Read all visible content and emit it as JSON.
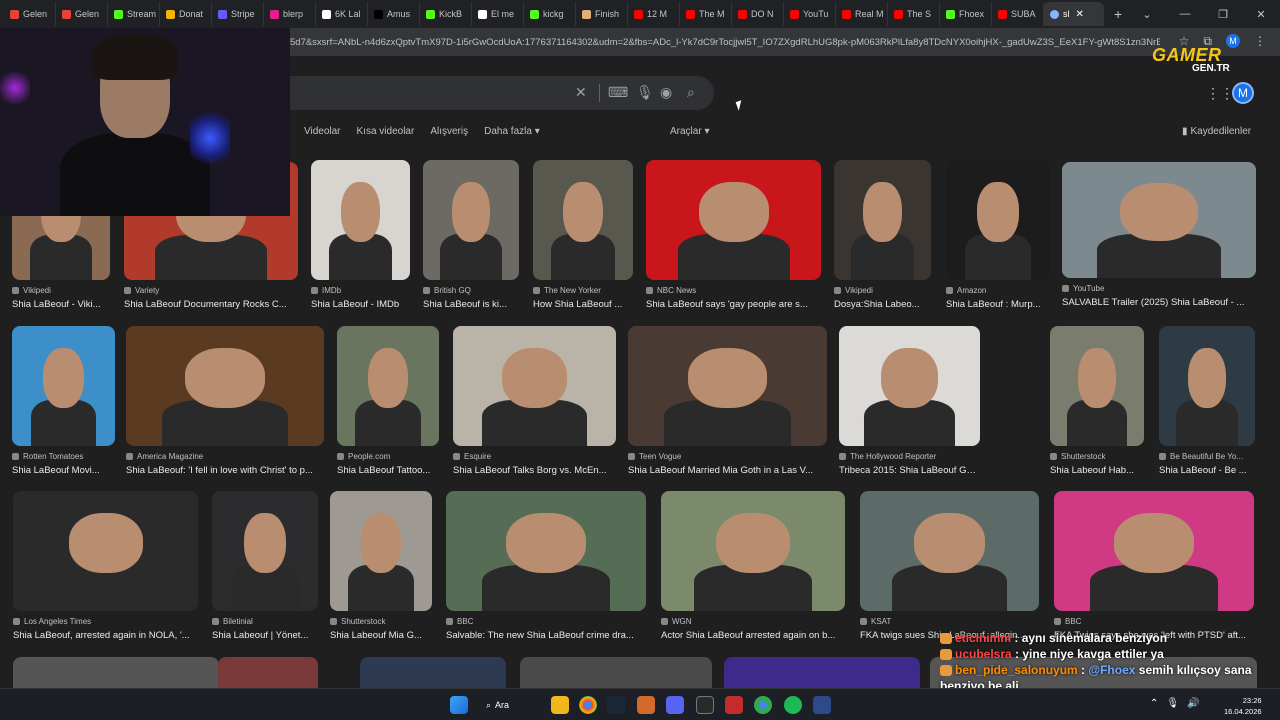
{
  "browser": {
    "tabs": [
      {
        "label": "Gelen",
        "color": "#ea4335"
      },
      {
        "label": "Gelen",
        "color": "#ea4335"
      },
      {
        "label": "Stream",
        "color": "#53fc18"
      },
      {
        "label": "Donat",
        "color": "#f4b400"
      },
      {
        "label": "Stripe",
        "color": "#635bff"
      },
      {
        "label": "blerp",
        "color": "#e91e8c"
      },
      {
        "label": "6K Lal",
        "color": "#ffffff"
      },
      {
        "label": "Amus",
        "color": "#000000"
      },
      {
        "label": "KickB",
        "color": "#53fc18"
      },
      {
        "label": "El me",
        "color": "#ffffff"
      },
      {
        "label": "kickg",
        "color": "#53fc18"
      },
      {
        "label": "Finish",
        "color": "#e2b077"
      },
      {
        "label": "12 M",
        "color": "#ff0000"
      },
      {
        "label": "The M",
        "color": "#ff0000"
      },
      {
        "label": "DO N",
        "color": "#ff0000"
      },
      {
        "label": "YouTu",
        "color": "#ff0000"
      },
      {
        "label": "Real M",
        "color": "#ff0000"
      },
      {
        "label": "The S",
        "color": "#ff0000"
      },
      {
        "label": "Fhoex",
        "color": "#53fc18"
      },
      {
        "label": "SUBA",
        "color": "#ff0000"
      }
    ],
    "active_tab": "sl",
    "url": "5d7&sxsrf=ANbL-n4d6zxQptvTmX97D-1i5rGwOcdUoA:1776371164302&udm=2&fbs=ADc_l-Yk7dC9rTocjjwl5T_IO7ZXgdRLhUG8pk-pM063RkPlLfa8y8TDcNYX0oihjHX-_gadUwZ3S_EeX1FY-gWt8S1zn3NrEJVcYP",
    "profile_initial": "M"
  },
  "overlay_logo": {
    "line1": "GAMER",
    "line2": "GEN.TR"
  },
  "search": {
    "value": ""
  },
  "filters": [
    "Videolar",
    "Kısa videolar",
    "Alışveriş",
    "Daha fazla ▾"
  ],
  "tools_label": "Araçlar ▾",
  "saved_label": "Kaydedilenler",
  "results": [
    {
      "source": "Vikipedi",
      "title": "Shia LaBeouf - Viki...",
      "bg": "#8a6a52"
    },
    {
      "source": "Variety",
      "title": "Shia LaBeouf Documentary Rocks C...",
      "bg": "#b23a2a"
    },
    {
      "source": "IMDb",
      "title": "Shia LaBeouf - IMDb",
      "bg": "#d8d4cf"
    },
    {
      "source": "British GQ",
      "title": "Shia LaBeouf is ki...",
      "bg": "#6c6a63"
    },
    {
      "source": "The New Yorker",
      "title": "How Shia LaBeouf ...",
      "bg": "#58584f"
    },
    {
      "source": "NBC News",
      "title": "Shia LaBeouf says 'gay people are s...",
      "bg": "#c8161b"
    },
    {
      "source": "Vikipedi",
      "title": "Dosya:Shia Labeo...",
      "bg": "#3a3530"
    },
    {
      "source": "Amazon",
      "title": "Shia LaBeouf : Murp...",
      "bg": "#1c1c1c"
    },
    {
      "source": "YouTube",
      "title": "SALVABLE Trailer (2025) Shia LaBeouf - ...",
      "bg": "#7c8a90"
    },
    {
      "source": "Rotten Tomatoes",
      "title": "Shia LaBeouf Movi...",
      "bg": "#3c8fc8"
    },
    {
      "source": "America Magazine",
      "title": "Shia LaBeouf: 'I fell in love with Christ' to p...",
      "bg": "#5a3a20"
    },
    {
      "source": "People.com",
      "title": "Shia LaBeouf Tattoo...",
      "bg": "#6a7560"
    },
    {
      "source": "Esquire",
      "title": "Shia LaBeouf Talks Borg vs. McEn...",
      "bg": "#b9b3a8"
    },
    {
      "source": "Teen Vogue",
      "title": "Shia LaBeouf Married Mia Goth in a Las V...",
      "bg": "#4a3a34"
    },
    {
      "source": "The Hollywood Reporter",
      "title": "Tribeca 2015: Shia LaBeouf Gets Candid ...",
      "bg": "#dcdad6"
    },
    {
      "source": "Shutterstock",
      "title": "Shia Labeouf Hab...",
      "bg": "#7a7c6e"
    },
    {
      "source": "Be Beautiful Be Yo...",
      "title": "Shia LaBeouf - Be ...",
      "bg": "#2e3a44"
    },
    {
      "source": "Los Angeles Times",
      "title": "Shia LaBeouf, arrested again in NOLA, '...",
      "bg": "#2a2a2a"
    },
    {
      "source": "Biletinial",
      "title": "Shia Labeouf | Yönet...",
      "bg": "#2c2c2e"
    },
    {
      "source": "Shutterstock",
      "title": "Shia Labeouf Mia G...",
      "bg": "#9e9a93"
    },
    {
      "source": "BBC",
      "title": "Salvable: The new Shia LaBeouf crime dra...",
      "bg": "#566d55"
    },
    {
      "source": "WGN",
      "title": "Actor Shia LaBeouf arrested again on b...",
      "bg": "#7a8a6a"
    },
    {
      "source": "KSAT",
      "title": "FKA twigs sues Shia LaBeouf, allegin...",
      "bg": "#5c6a68"
    },
    {
      "source": "BBC",
      "title": "FKA Twigs says she was 'left with PTSD' aft...",
      "bg": "#d03a84"
    }
  ],
  "row4": [
    {
      "bg": "#555"
    },
    {
      "bg": "#7a3a3a"
    },
    {
      "bg": "#2e3a52"
    },
    {
      "bg": "#4a4a4a"
    },
    {
      "bg": "#3d2a8a"
    },
    {
      "bg": "#555"
    }
  ],
  "chat": [
    {
      "user": "eticinimm",
      "text": "aynı sinemalara benziyon"
    },
    {
      "user": "ucubelsra",
      "text": "yine niye kavga ettiler ya"
    },
    {
      "user": "ben_pide_salonuyum",
      "mention": "@Fhoex",
      "text": "semih kılıçsoy sana benziyo be ali"
    }
  ],
  "taskbar": {
    "search_label": "Ara",
    "time": "23:26",
    "date": "16.04.2026"
  }
}
